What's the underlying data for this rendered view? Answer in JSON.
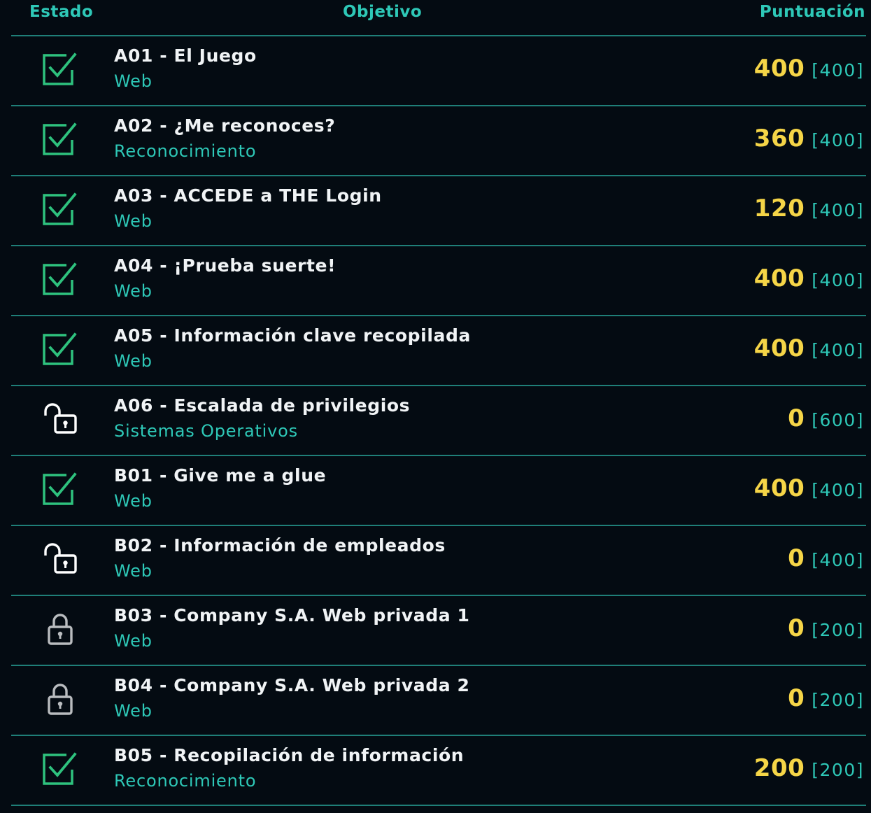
{
  "header": {
    "estado": "Estado",
    "objetivo": "Objetivo",
    "puntuacion": "Puntuación"
  },
  "colors": {
    "background": "#040b12",
    "accent": "#2ec8b7",
    "score": "#f5d547",
    "done_icon": "#2ec27e",
    "text": "#f1f4f6"
  },
  "rows": [
    {
      "status": "checkbox-checked-icon",
      "name": "A01 - El Juego",
      "category": "Web",
      "score": "400",
      "max": "[400]"
    },
    {
      "status": "checkbox-checked-icon",
      "name": "A02 - ¿Me reconoces?",
      "category": "Reconocimiento",
      "score": "360",
      "max": "[400]"
    },
    {
      "status": "checkbox-checked-icon",
      "name": "A03 - ACCEDE a THE Login",
      "category": "Web",
      "score": "120",
      "max": "[400]"
    },
    {
      "status": "checkbox-checked-icon",
      "name": "A04 - ¡Prueba suerte!",
      "category": "Web",
      "score": "400",
      "max": "[400]"
    },
    {
      "status": "checkbox-checked-icon",
      "name": "A05 - Información clave recopilada",
      "category": "Web",
      "score": "400",
      "max": "[400]"
    },
    {
      "status": "lock-open-icon",
      "name": "A06 - Escalada de privilegios",
      "category": "Sistemas Operativos",
      "score": "0",
      "max": "[600]"
    },
    {
      "status": "checkbox-checked-icon",
      "name": "B01 - Give me a glue",
      "category": "Web",
      "score": "400",
      "max": "[400]"
    },
    {
      "status": "lock-open-icon",
      "name": "B02 - Información de empleados",
      "category": "Web",
      "score": "0",
      "max": "[400]"
    },
    {
      "status": "lock-closed-icon",
      "name": "B03 - Company S.A. Web privada 1",
      "category": "Web",
      "score": "0",
      "max": "[200]"
    },
    {
      "status": "lock-closed-icon",
      "name": "B04 - Company S.A. Web privada 2",
      "category": "Web",
      "score": "0",
      "max": "[200]"
    },
    {
      "status": "checkbox-checked-icon",
      "name": "B05 - Recopilación de información",
      "category": "Reconocimiento",
      "score": "200",
      "max": "[200]"
    }
  ]
}
